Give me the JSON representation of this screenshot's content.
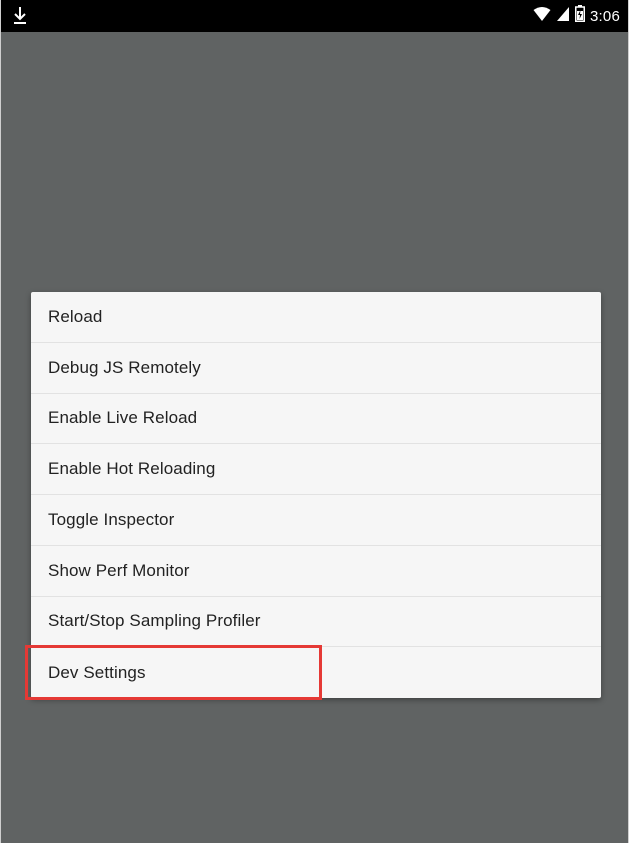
{
  "status_bar": {
    "time": "3:06",
    "icons": [
      "download-icon",
      "wifi-icon",
      "signal-icon",
      "battery-icon"
    ]
  },
  "dev_menu": {
    "items": [
      {
        "label": "Reload"
      },
      {
        "label": "Debug JS Remotely"
      },
      {
        "label": "Enable Live Reload"
      },
      {
        "label": "Enable Hot Reloading"
      },
      {
        "label": "Toggle Inspector"
      },
      {
        "label": "Show Perf Monitor"
      },
      {
        "label": "Start/Stop Sampling Profiler"
      },
      {
        "label": "Dev Settings"
      }
    ]
  },
  "colors": {
    "backdrop": "#606363",
    "dialog": "#f6f6f6",
    "highlight": "#e53935"
  }
}
